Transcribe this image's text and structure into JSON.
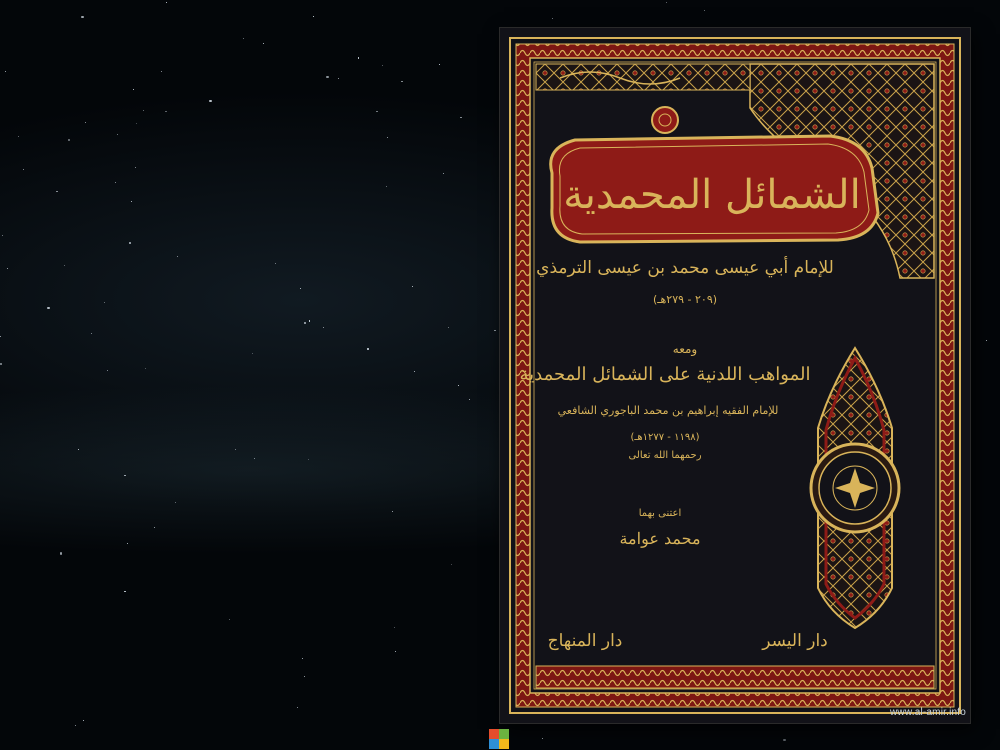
{
  "cover": {
    "title": "الشمائل المحمدية",
    "author": "للإمام أبي عيسى محمد بن عيسى الترمذي",
    "author_dates": "(٢٠٩ - ٢٧٩هـ)",
    "with_label": "ومعه",
    "subtitle": "المواهب اللدنية على الشمائل المحمدية",
    "commentator": "للإمام الفقيه إبراهيم بن محمد الباجوري الشافعي",
    "commentator_dates": "(١١٩٨ - ١٢٧٧هـ)",
    "mercy": "رحمهما الله تعالى",
    "editor_label": "اعتنى بهما",
    "editor": "محمد عوامة",
    "publisher_right": "دار اليسر",
    "publisher_left": "دار المنهاج"
  },
  "watermark": "www.al-amir.info",
  "colors": {
    "gold": "#d9b45a",
    "red": "#8e1b17",
    "cover": "#121218"
  },
  "taskbar": {
    "launcher_icon": "windows-logo-icon"
  }
}
